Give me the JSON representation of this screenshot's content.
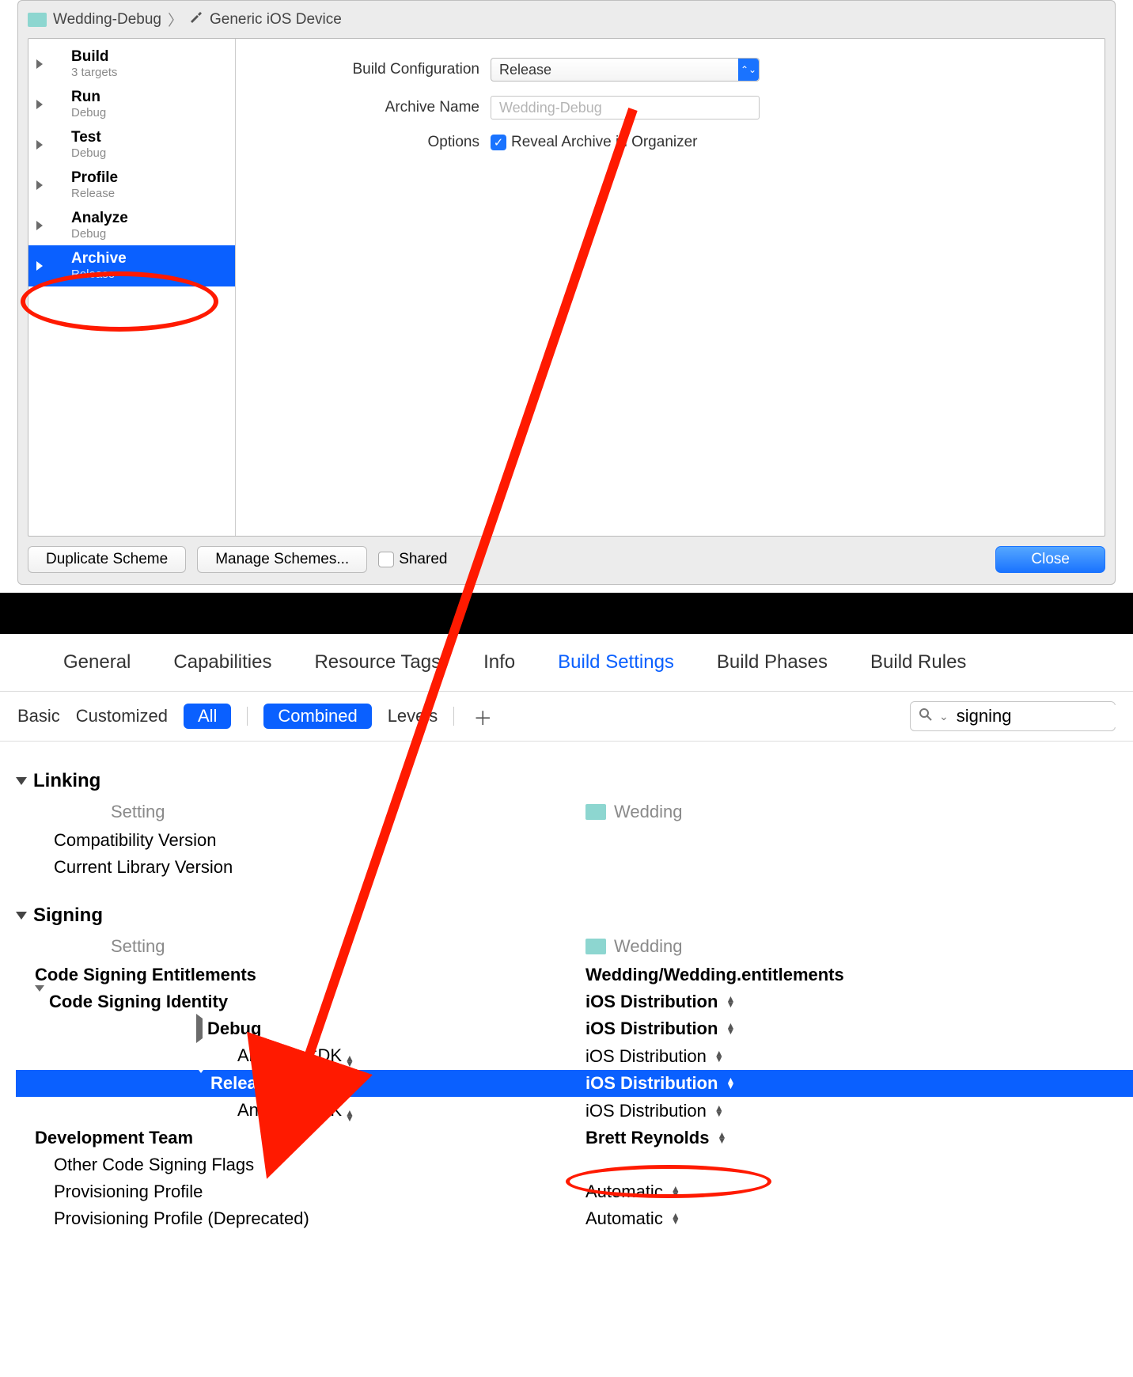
{
  "breadcrumb": {
    "scheme": "Wedding-Debug",
    "destination": "Generic iOS Device"
  },
  "actions": [
    {
      "title": "Build",
      "sub": "3 targets",
      "icon": "hammer-icon"
    },
    {
      "title": "Run",
      "sub": "Debug",
      "icon": "play-icon"
    },
    {
      "title": "Test",
      "sub": "Debug",
      "icon": "wrench-icon"
    },
    {
      "title": "Profile",
      "sub": "Release",
      "icon": "gauge-icon"
    },
    {
      "title": "Analyze",
      "sub": "Debug",
      "icon": "analyze-icon"
    },
    {
      "title": "Archive",
      "sub": "Release",
      "icon": "archive-icon",
      "selected": true
    }
  ],
  "form": {
    "build_config_label": "Build Configuration",
    "build_config_value": "Release",
    "archive_name_label": "Archive Name",
    "archive_name_placeholder": "Wedding-Debug",
    "options_label": "Options",
    "reveal_label": "Reveal Archive in Organizer",
    "reveal_checked": true
  },
  "footer": {
    "duplicate": "Duplicate Scheme",
    "manage": "Manage Schemes...",
    "shared": "Shared",
    "close": "Close"
  },
  "tabs": {
    "items": [
      "General",
      "Capabilities",
      "Resource Tags",
      "Info",
      "Build Settings",
      "Build Phases",
      "Build Rules"
    ],
    "active": "Build Settings"
  },
  "filter": {
    "scopes": {
      "basic": "Basic",
      "customized": "Customized",
      "all": "All"
    },
    "views": {
      "combined": "Combined",
      "levels": "Levels"
    },
    "search_value": "signing"
  },
  "columns": {
    "setting": "Setting",
    "project": "Wedding"
  },
  "sections": [
    {
      "title": "Linking",
      "rows": [
        {
          "name": "Compatibility Version",
          "val": "",
          "indent": 1
        },
        {
          "name": "Current Library Version",
          "val": "",
          "indent": 1
        }
      ]
    },
    {
      "title": "Signing",
      "rows": [
        {
          "name": "Code Signing Entitlements",
          "val": "Wedding/Wedding.entitlements",
          "indent": 0,
          "bold": true
        },
        {
          "name": "Code Signing Identity",
          "val": "iOS Distribution",
          "indent": 0,
          "bold": true,
          "updown": true,
          "disclose": "down"
        },
        {
          "name": "Debug",
          "val": "iOS Distribution",
          "indent": 2,
          "bold": true,
          "updown": true,
          "disclose": "right"
        },
        {
          "name": "Any iOS SDK",
          "val": "iOS Distribution",
          "indent": 3,
          "updown": true,
          "selupdown": true
        },
        {
          "name": "Release",
          "val": "iOS Distribution",
          "indent": 2,
          "bold": true,
          "updown": true,
          "selected": true,
          "disclose": "down"
        },
        {
          "name": "Any iOS SDK",
          "val": "iOS Distribution",
          "indent": 3,
          "updown": true,
          "selupdown": true
        },
        {
          "name": "Development Team",
          "val": "Brett Reynolds",
          "indent": 0,
          "bold": true,
          "updown": true
        },
        {
          "name": "Other Code Signing Flags",
          "val": "",
          "indent": 1
        },
        {
          "name": "Provisioning Profile",
          "val": "Automatic",
          "indent": 1,
          "updown": true
        },
        {
          "name": "Provisioning Profile (Deprecated)",
          "val": "Automatic",
          "indent": 1,
          "updown": true
        }
      ]
    }
  ]
}
